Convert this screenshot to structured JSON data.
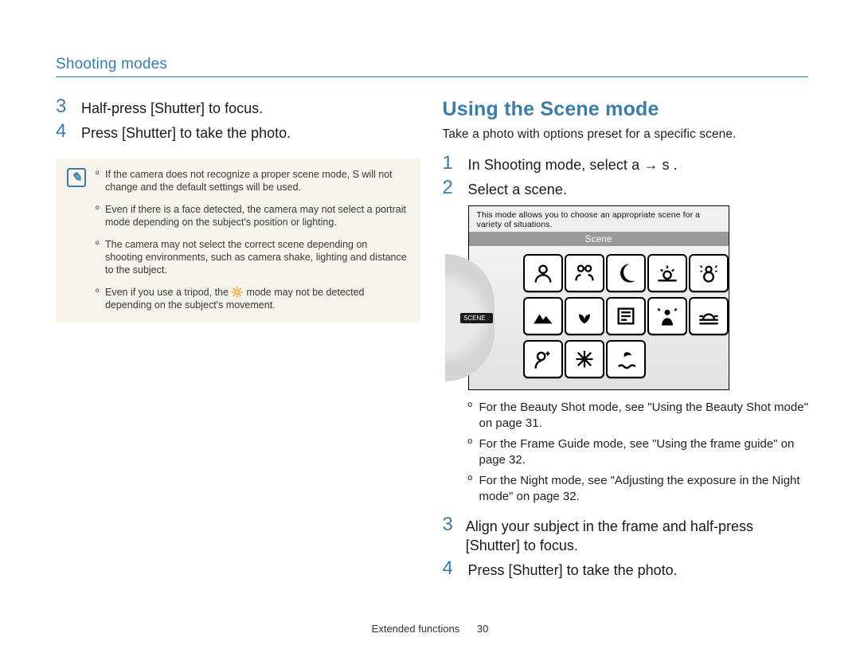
{
  "header": {
    "title": "Shooting modes"
  },
  "left": {
    "steps": [
      {
        "n": "3",
        "text": "Half-press [Shutter] to focus."
      },
      {
        "n": "4",
        "text": "Press [Shutter] to take the photo."
      }
    ],
    "notes": [
      "If the camera does not recognize a proper scene mode, S will not change and the default settings will be used.",
      "Even if there is a face detected, the camera may not select a portrait mode depending on the subject's position or lighting.",
      "The camera may not select the correct scene depending on shooting environments, such as camera shake, lighting and distance to the subject.",
      "Even if you use a tripod, the 🔆 mode may not be detected depending on the subject's movement."
    ]
  },
  "right": {
    "title": "Using the Scene mode",
    "lead": "Take a photo with options preset for a specific scene.",
    "steps_top": [
      {
        "n": "1",
        "text": "In Shooting mode, select a → s ."
      },
      {
        "n": "2",
        "text": "Select a scene."
      }
    ],
    "sceneshot": {
      "caption": "This mode allows you to choose an appropriate scene for a variety of situations.",
      "bar_label": "Scene",
      "dial_tab": "SCENE",
      "icons": [
        {
          "name": "portrait-icon",
          "glyph": "portrait"
        },
        {
          "name": "children-icon",
          "glyph": "children"
        },
        {
          "name": "night-icon",
          "glyph": "night"
        },
        {
          "name": "dawn-icon",
          "glyph": "dawn"
        },
        {
          "name": "snow-icon",
          "glyph": "snow"
        },
        {
          "name": "landscape-icon",
          "glyph": "landscape"
        },
        {
          "name": "closeup-icon",
          "glyph": "closeup"
        },
        {
          "name": "text-icon",
          "glyph": "text"
        },
        {
          "name": "backlight-icon",
          "glyph": "backlight"
        },
        {
          "name": "sunset-icon",
          "glyph": "sunset"
        },
        {
          "name": "beauty-icon",
          "glyph": "beauty"
        },
        {
          "name": "firework-icon",
          "glyph": "firework"
        },
        {
          "name": "beach-icon",
          "glyph": "beach"
        }
      ]
    },
    "sub_bullets": [
      "For the Beauty Shot mode, see \"Using the Beauty Shot mode\" on page 31.",
      "For the Frame Guide mode, see \"Using the frame guide\" on page 32.",
      "For the Night mode, see \"Adjusting the exposure in the Night mode\" on page 32."
    ],
    "steps_bottom": [
      {
        "n": "3",
        "text": "Align your subject in the frame and half-press [Shutter] to focus."
      },
      {
        "n": "4",
        "text": "Press [Shutter] to take the photo."
      }
    ]
  },
  "footer": {
    "section": "Extended functions",
    "page": "30"
  }
}
